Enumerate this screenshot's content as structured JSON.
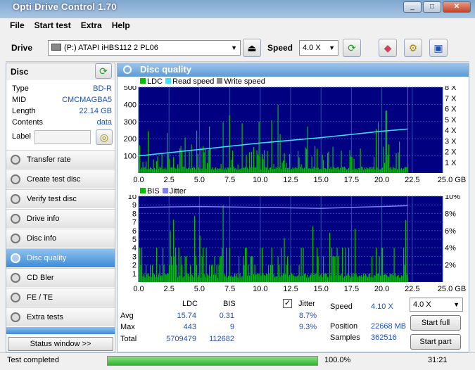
{
  "window": {
    "title": "Opti Drive Control 1.70"
  },
  "menu": [
    "File",
    "Start test",
    "Extra",
    "Help"
  ],
  "toolbar": {
    "drive_label": "Drive",
    "drive_value": "(P:)  ATAPI iHBS112  2 PL06",
    "speed_label": "Speed",
    "speed_value": "4.0 X"
  },
  "disc": {
    "header": "Disc",
    "rows": [
      {
        "key": "Type",
        "value": "BD-R"
      },
      {
        "key": "MID",
        "value": "CMCMAGBA5"
      },
      {
        "key": "Length",
        "value": "22.14 GB"
      },
      {
        "key": "Contents",
        "value": "data"
      }
    ],
    "label_key": "Label"
  },
  "nav": [
    {
      "label": "Transfer rate",
      "selected": false
    },
    {
      "label": "Create test disc",
      "selected": false
    },
    {
      "label": "Verify test disc",
      "selected": false
    },
    {
      "label": "Drive info",
      "selected": false
    },
    {
      "label": "Disc info",
      "selected": false
    },
    {
      "label": "Disc quality",
      "selected": true
    },
    {
      "label": "CD Bler",
      "selected": false
    },
    {
      "label": "FE / TE",
      "selected": false
    },
    {
      "label": "Extra tests",
      "selected": false
    }
  ],
  "status_window_button": "Status window >>",
  "panel": {
    "title": "Disc quality"
  },
  "chart1_legend": {
    "ldc": "LDC",
    "read": "Read speed",
    "write": "Write speed"
  },
  "chart2_legend": {
    "bis": "BIS",
    "jitter": "Jitter"
  },
  "chart_data": [
    {
      "type": "bar",
      "title": "",
      "series": [
        {
          "name": "LDC"
        },
        {
          "name": "Read speed"
        },
        {
          "name": "Write speed"
        }
      ],
      "xlabel": "",
      "ylabel": "",
      "x_ticks": [
        "0.0",
        "2.5",
        "5.0",
        "7.5",
        "10.0",
        "12.5",
        "15.0",
        "17.5",
        "20.0",
        "22.5",
        "25.0 GB"
      ],
      "y_ticks": [
        "500",
        "400",
        "300",
        "200",
        "100"
      ],
      "y2_ticks": [
        "8 X",
        "7 X",
        "6 X",
        "5 X",
        "4 X",
        "3 X",
        "2 X",
        "1 X"
      ],
      "xlim": [
        0,
        25
      ],
      "ylim": [
        0,
        500
      ],
      "y2lim": [
        0,
        8
      ],
      "read_speed": {
        "x": [
          0,
          5,
          10,
          15,
          20,
          22.1
        ],
        "y": [
          1.6,
          2.2,
          2.8,
          3.3,
          3.9,
          4.1
        ]
      }
    },
    {
      "type": "bar",
      "title": "",
      "series": [
        {
          "name": "BIS"
        },
        {
          "name": "Jitter"
        }
      ],
      "x_ticks": [
        "0.0",
        "2.5",
        "5.0",
        "7.5",
        "10.0",
        "12.5",
        "15.0",
        "17.5",
        "20.0",
        "22.5",
        "25.0 GB"
      ],
      "y_ticks": [
        "10",
        "9",
        "8",
        "7",
        "6",
        "5",
        "4",
        "3",
        "2",
        "1"
      ],
      "y2_ticks": [
        "10%",
        "8%",
        "6%",
        "4%",
        "2%"
      ],
      "xlim": [
        0,
        25
      ],
      "ylim": [
        0,
        10
      ],
      "y2lim": [
        0,
        10
      ],
      "jitter": {
        "x": [
          0,
          5,
          10,
          15,
          20,
          22.1
        ],
        "y": [
          8.7,
          8.8,
          8.7,
          8.6,
          8.8,
          8.9
        ]
      }
    }
  ],
  "stats": {
    "col_ldc": "LDC",
    "col_bis": "BIS",
    "jitter_label": "Jitter",
    "avg_label": "Avg",
    "max_label": "Max",
    "total_label": "Total",
    "avg_ldc": "15.74",
    "avg_bis": "0.31",
    "avg_jitter": "8.7%",
    "max_ldc": "443",
    "max_bis": "9",
    "max_jitter": "9.3%",
    "total_ldc": "5709479",
    "total_bis": "112682",
    "speed_label": "Speed",
    "speed_value": "4.10 X",
    "position_label": "Position",
    "position_value": "22668 MB",
    "samples_label": "Samples",
    "samples_value": "362516",
    "speed_select": "4.0 X",
    "start_full": "Start full",
    "start_part": "Start part"
  },
  "statusbar": {
    "text": "Test completed",
    "progress_text": "100.0%",
    "progress": 1.0,
    "time": "31:21"
  },
  "colors": {
    "plot_bg": "#000080",
    "ldc": "#00c000",
    "read": "#40e0ff",
    "jitter": "#8080ff",
    "highlight": "#3d8bd8"
  }
}
